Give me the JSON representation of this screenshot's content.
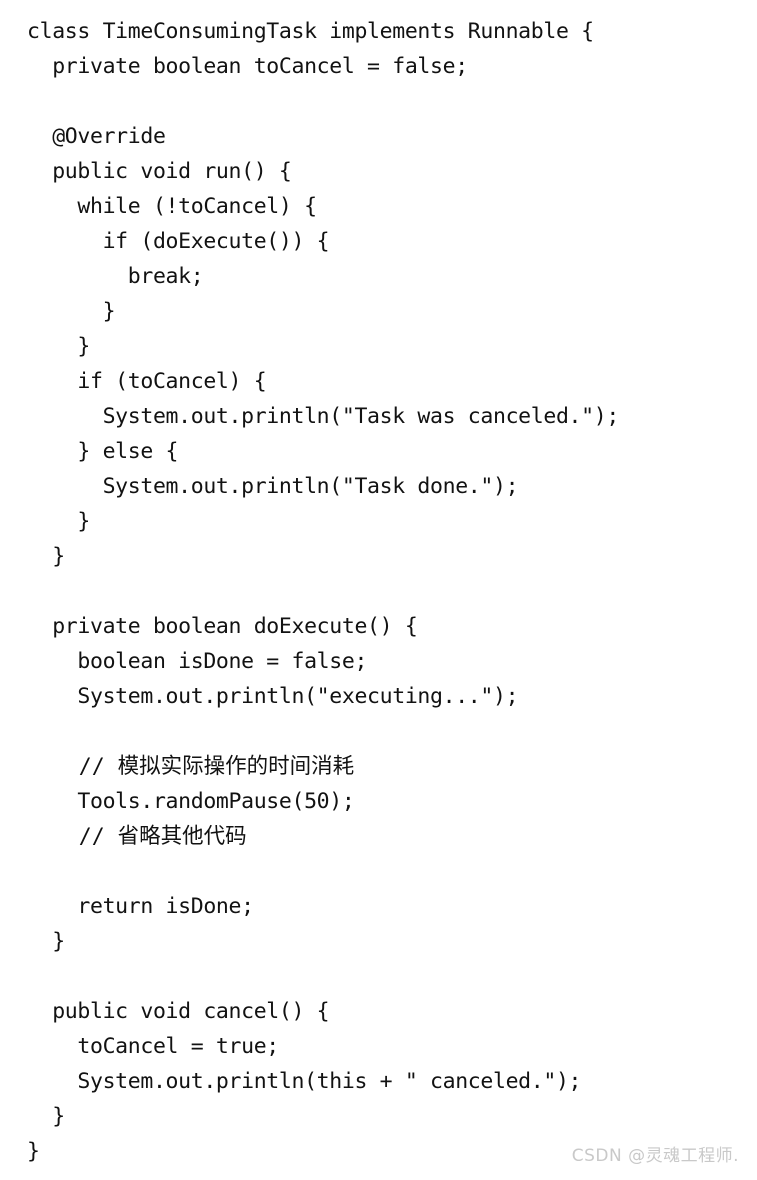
{
  "page": {
    "background_color": "#ffffff",
    "text_color": "#121212",
    "kind": "scanned-code-listing",
    "language": "Java"
  },
  "code": {
    "lines": [
      "class TimeConsumingTask implements Runnable {",
      "  private boolean toCancel = false;",
      "",
      "  @Override",
      "  public void run() {",
      "    while (!toCancel) {",
      "      if (doExecute()) {",
      "        break;",
      "      }",
      "    }",
      "    if (toCancel) {",
      "      System.out.println(\"Task was canceled.\");",
      "    } else {",
      "      System.out.println(\"Task done.\");",
      "    }",
      "  }",
      "",
      "  private boolean doExecute() {",
      "    boolean isDone = false;",
      "    System.out.println(\"executing...\");",
      "",
      "    // 模拟实际操作的时间消耗",
      "    Tools.randomPause(50);",
      "    // 省略其他代码",
      "",
      "    return isDone;",
      "  }",
      "",
      "  public void cancel() {",
      "    toCancel = true;",
      "    System.out.println(this + \" canceled.\");",
      "  }",
      "}"
    ]
  },
  "watermark": {
    "text": "CSDN @灵魂工程师.",
    "color": "#c9c9c9"
  }
}
